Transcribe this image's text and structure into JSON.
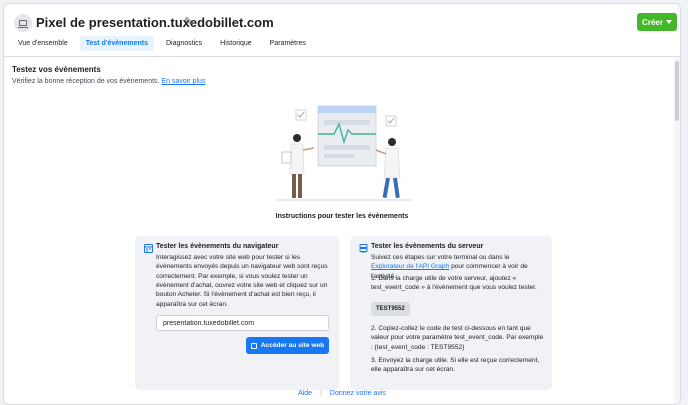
{
  "header": {
    "title": "Pixel de presentation.tuxedobillet.com",
    "create_label": "Créer",
    "pixel_icon": "monitor-icon",
    "edit_icon": "pencil-icon"
  },
  "tabs": [
    {
      "label": "Vue d'ensemble"
    },
    {
      "label": "Test d'évènements",
      "active": true
    },
    {
      "label": "Diagnostics"
    },
    {
      "label": "Historique"
    },
    {
      "label": "Paramètres"
    }
  ],
  "section": {
    "title": "Testez vos évènements",
    "description": "Vérifiez la bonne réception de vos évènements.",
    "learn_more": "En savoir plus"
  },
  "instructions_title": "Instructions pour tester les évènements",
  "browser_card": {
    "icon": "browser-icon",
    "title": "Tester les évènements du navigateur",
    "text": "Interagissez avec votre site web pour tester si les évènements envoyés depuis un navigateur web sont reçus correctement. Par exemple, si vous voulez tester un évènement d'achat, ouvrez votre site web et cliquez sur un bouton Acheter. Si l'évènement d'achat est bien reçu, il apparaîtra sur cet écran.",
    "input_value": "presentation.tuxedobillet.com",
    "button_label": "Accéder au site web"
  },
  "server_card": {
    "icon": "server-icon",
    "title": "Tester les évènements du serveur",
    "intro_before": "Suivez ces étapes sur votre terminal ou dans le ",
    "intro_link": "Explorateur de l'API Graph",
    "intro_after": " pour commencer à voir de l'activité.",
    "step1": "1. Dans la charge utile de votre serveur, ajoutez « test_event_code » à l'évènement que vous voulez tester.",
    "code": "TEST9552",
    "step2": "2. Copiez-collez le code de test ci-dessous en tant que valeur pour votre paramètre test_event_code. Par exemple : {test_event_code : TEST9552}",
    "step3": "3. Envoyez la charge utile. Si elle est reçue correctement, elle apparaîtra sur cet écran."
  },
  "footer": {
    "help": "Aide",
    "feedback": "Donnez votre avis"
  },
  "colors": {
    "accent": "#1877f2",
    "create": "#42b72a",
    "card_bg": "#f0f2f5"
  }
}
